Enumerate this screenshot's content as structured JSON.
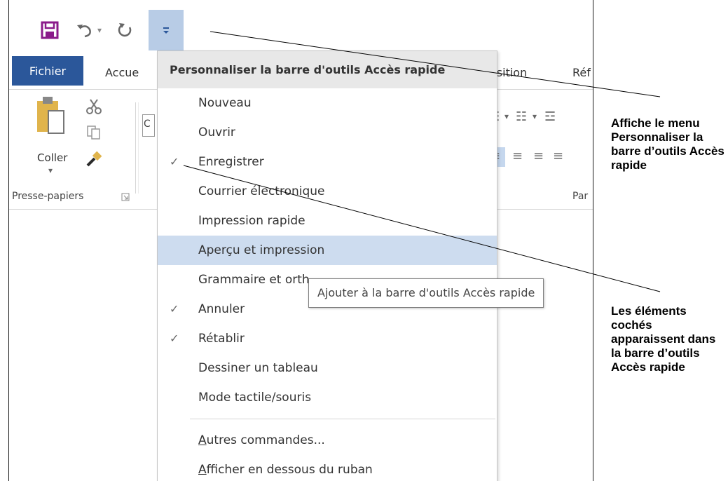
{
  "quick_access": {
    "save_icon": "save-icon",
    "undo_icon": "undo-icon",
    "redo_icon": "redo-icon",
    "customize_icon": "customize-qat-icon"
  },
  "tabs": {
    "file": "Fichier",
    "home": "Accue",
    "layout": "osition",
    "refs": "Réf"
  },
  "ribbon": {
    "paste_label": "Coller",
    "clipboard_group": "Presse-papiers",
    "font_box_char": "C",
    "paragraph_group": "Par"
  },
  "menu": {
    "title": "Personnaliser la barre d'outils Accès rapide",
    "items": [
      {
        "label": "Nouveau",
        "checked": false
      },
      {
        "label": "Ouvrir",
        "checked": false
      },
      {
        "label": "Enregistrer",
        "checked": true
      },
      {
        "label": "Courrier électronique",
        "checked": false
      },
      {
        "label": "Impression rapide",
        "checked": false
      },
      {
        "label": "Aperçu et impression",
        "checked": false
      },
      {
        "label": "Grammaire et orth",
        "checked": false
      },
      {
        "label": "Annuler",
        "checked": true
      },
      {
        "label": "Rétablir",
        "checked": true
      },
      {
        "label": "Dessiner un tableau",
        "checked": false
      },
      {
        "label": "Mode tactile/souris",
        "checked": false
      }
    ],
    "more": {
      "accel": "A",
      "rest": "utres commandes..."
    },
    "below": {
      "accel": "A",
      "rest": "fficher en dessous du ruban"
    },
    "check_glyph": "✓"
  },
  "tooltip": "Ajouter à la barre d'outils Accès rapide",
  "annotations": {
    "customize_menu": "Affiche le menu Personnaliser la barre d’outils Accès rapide",
    "checked_items": "Les éléments cochés apparaissent dans la barre d’outils Accès rapide"
  },
  "colors": {
    "file_tab": "#2b579a",
    "save_icon": "#8a1a8a",
    "highlight": "#cddcef",
    "customize_button": "#b8cce6"
  }
}
